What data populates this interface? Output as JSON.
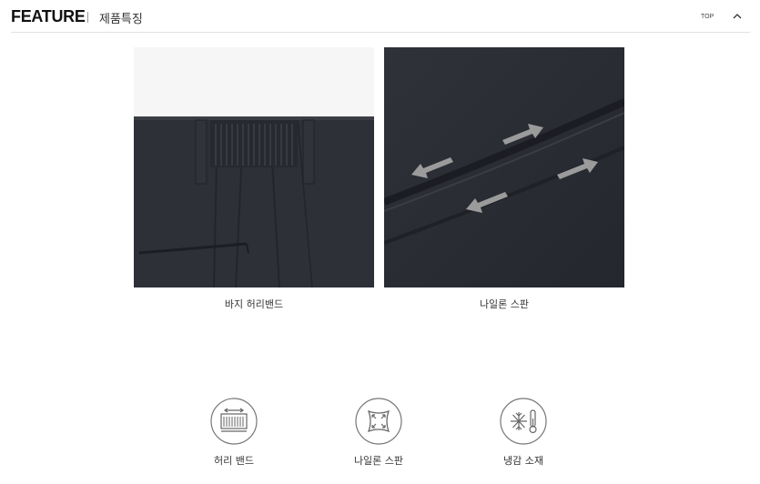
{
  "header": {
    "title_en": "FEATURE",
    "title_kr": "제품특징",
    "top_label": "TOP"
  },
  "photos": [
    {
      "caption": "바지 허리밴드"
    },
    {
      "caption": "나일론 스판"
    }
  ],
  "features": [
    {
      "label": "허리 밴드",
      "icon": "waistband-icon"
    },
    {
      "label": "나일론 스판",
      "icon": "stretch-icon"
    },
    {
      "label": "냉감 소재",
      "icon": "cooling-icon"
    }
  ],
  "colors": {
    "fabric": "#2b2e34",
    "icon_stroke": "#666666"
  }
}
